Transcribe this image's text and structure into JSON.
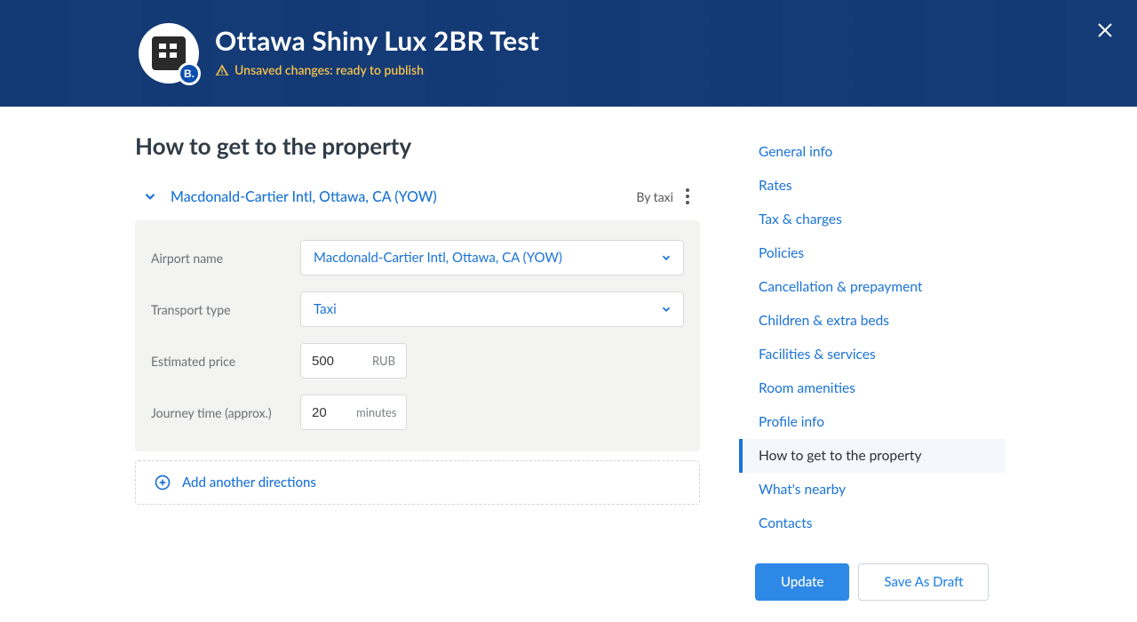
{
  "header": {
    "title": "Ottawa Shiny Lux 2BR Test",
    "status_text": "Unsaved changes: ready to publish",
    "badge_letter": "B."
  },
  "page": {
    "title": "How to get to the property"
  },
  "accordion": {
    "title": "Macdonald-Cartier Intl, Ottawa, CA (YOW)",
    "meta": "By taxi"
  },
  "form": {
    "airport_name": {
      "label": "Airport name",
      "value": "Macdonald-Cartier Intl, Ottawa, CA (YOW)"
    },
    "transport_type": {
      "label": "Transport type",
      "value": "Taxi"
    },
    "estimated_price": {
      "label": "Estimated price",
      "value": "500",
      "unit": "RUB"
    },
    "journey_time": {
      "label": "Journey time (approx.)",
      "value": "20",
      "unit": "minutes"
    }
  },
  "add_button": "Add another directions",
  "nav": {
    "items": [
      "General info",
      "Rates",
      "Tax & charges",
      "Policies",
      "Cancellation & prepayment",
      "Children & extra beds",
      "Facilities & services",
      "Room amenities",
      "Profile info",
      "How to get to the property",
      "What's nearby",
      "Contacts"
    ],
    "active_index": 9
  },
  "actions": {
    "primary": "Update",
    "secondary": "Save As Draft"
  }
}
